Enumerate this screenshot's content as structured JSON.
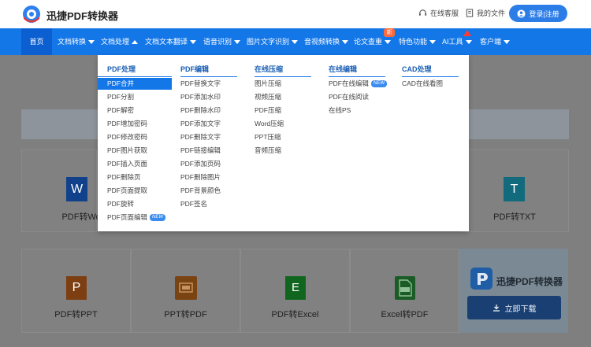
{
  "header": {
    "brand": "迅捷PDF转换器",
    "service": "在线客服",
    "my_files": "我的文件",
    "login": "登录|注册"
  },
  "nav": {
    "home": "首页",
    "items": [
      "文档转换",
      "文档处理",
      "文档文本翻译",
      "语音识别",
      "图片文字识别",
      "音视频转换",
      "论文查重",
      "特色功能",
      "AI工具",
      "客户端"
    ],
    "new_badge": "新"
  },
  "dropdown": {
    "columns": [
      {
        "title": "PDF处理",
        "items": [
          "PDF合并",
          "PDF分割",
          "PDF解密",
          "PDF增加密码",
          "PDF修改密码",
          "PDF图片获取",
          "PDF插入页面",
          "PDF删除页",
          "PDF页面提取",
          "PDF旋转",
          "PDF页面编辑"
        ]
      },
      {
        "title": "PDF编辑",
        "items": [
          "PDF替换文字",
          "PDF添加水印",
          "PDF删除水印",
          "PDF添加文字",
          "PDF删除文字",
          "PDF链接编辑",
          "PDF添加页码",
          "PDF删除图片",
          "PDF背景颜色",
          "PDF签名"
        ]
      },
      {
        "title": "在线压缩",
        "items": [
          "图片压缩",
          "视频压缩",
          "PDF压缩",
          "Word压缩",
          "PPT压缩",
          "音频压缩"
        ]
      },
      {
        "title": "在线编辑",
        "items": [
          "PDF在线编辑",
          "PDF在线阅读",
          "在线PS"
        ]
      },
      {
        "title": "CAD处理",
        "items": [
          "CAD在线看图"
        ]
      }
    ],
    "new_tag": "NEW"
  },
  "cards": {
    "row1": [
      "PDF转Word",
      "PDF转TXT"
    ],
    "row2": [
      "PDF转PPT",
      "PPT转PDF",
      "PDF转Excel",
      "Excel转PDF"
    ]
  },
  "promo": {
    "title": "迅捷PDF转换器",
    "button": "立即下载"
  },
  "icons": {
    "word": "W",
    "txt": "T",
    "ppt": "P",
    "excel": "E"
  },
  "colors": {
    "primary": "#1477e8",
    "accent": "#ff6a3d"
  }
}
